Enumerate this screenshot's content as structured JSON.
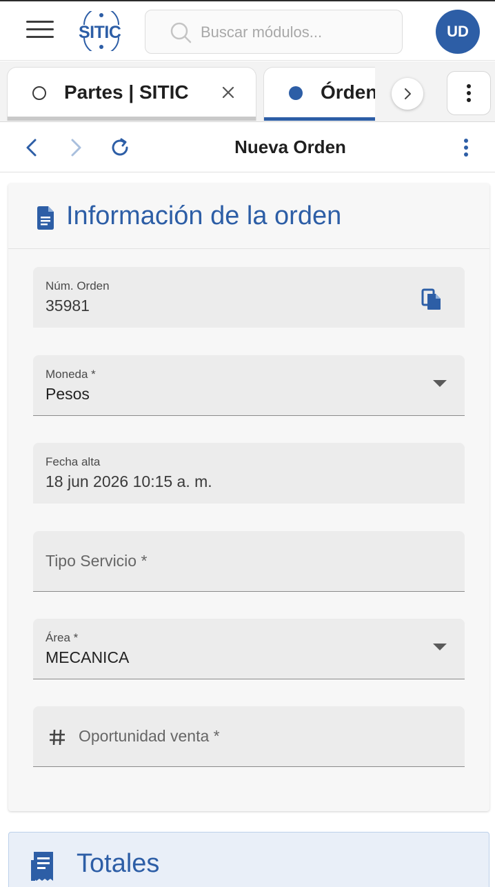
{
  "header": {
    "logo_text": "SITIC",
    "search_placeholder": "Buscar módulos...",
    "avatar_initials": "UD"
  },
  "tabs": [
    {
      "label": "Partes | SITIC",
      "active": false
    },
    {
      "label": "Órden",
      "active": true
    }
  ],
  "nav": {
    "title": "Nueva Orden"
  },
  "order_info": {
    "title": "Información de la orden",
    "fields": {
      "num_orden": {
        "label": "Núm. Orden",
        "value": "35981"
      },
      "moneda": {
        "label": "Moneda *",
        "value": "Pesos"
      },
      "fecha_alta": {
        "label": "Fecha alta",
        "value": "18 jun 2026 10:15 a. m."
      },
      "tipo_servicio": {
        "placeholder": "Tipo Servicio *"
      },
      "area": {
        "label": "Área *",
        "value": "MECANICA"
      },
      "oportunidad_venta": {
        "placeholder": "Oportunidad venta *"
      }
    }
  },
  "totales": {
    "title": "Totales"
  },
  "colors": {
    "brand_blue": "#2d5ea6",
    "field_bg": "#ececec",
    "card_bg": "#f7f7f7"
  },
  "icons": {
    "menu": "hamburger-icon",
    "search": "search-icon",
    "tab_inactive": "circle-outline-icon",
    "tab_active": "circle-filled-icon",
    "close": "close-icon",
    "scroll": "chevron-right-icon",
    "more": "more-vertical-icon",
    "back": "chevron-left-icon",
    "forward": "chevron-right-icon",
    "refresh": "refresh-icon",
    "document": "document-icon",
    "copy": "copy-icon",
    "hash": "hash-icon",
    "receipt": "receipt-icon"
  }
}
